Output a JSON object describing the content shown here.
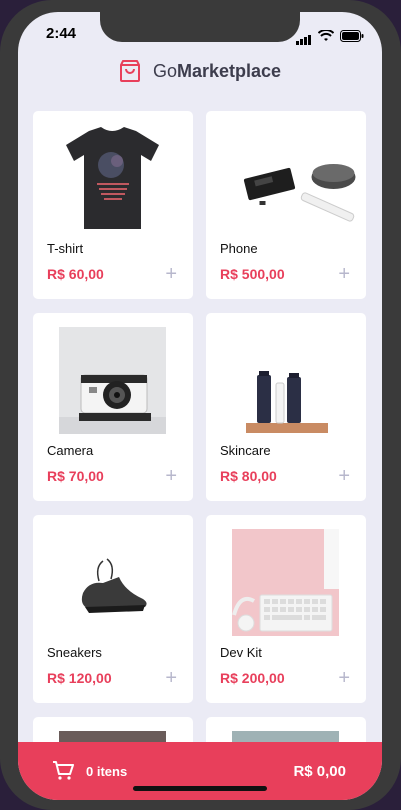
{
  "status": {
    "time": "2:44"
  },
  "header": {
    "brand_light": "Go",
    "brand_bold": "Marketplace"
  },
  "products": [
    {
      "title": "T-shirt",
      "price": "R$ 60,00"
    },
    {
      "title": "Phone",
      "price": "R$ 500,00"
    },
    {
      "title": "Camera",
      "price": "R$ 70,00"
    },
    {
      "title": "Skincare",
      "price": "R$ 80,00"
    },
    {
      "title": "Sneakers",
      "price": "R$ 120,00"
    },
    {
      "title": "Dev Kit",
      "price": "R$ 200,00"
    }
  ],
  "cart": {
    "count_label": "0 itens",
    "total": "R$ 0,00"
  },
  "colors": {
    "accent": "#e83f5b",
    "background": "#ebebf5"
  }
}
